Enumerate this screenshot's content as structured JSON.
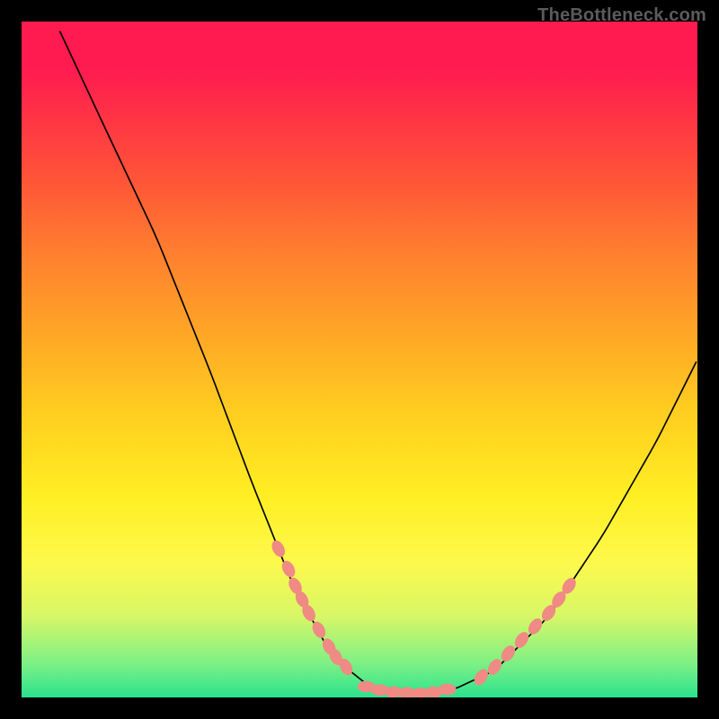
{
  "watermark": "TheBottleneck.com",
  "chart_data": {
    "type": "line",
    "title": "",
    "xlabel": "",
    "ylabel": "",
    "xlim": [
      0,
      100
    ],
    "ylim": [
      0,
      100
    ],
    "curve": {
      "name": "bottleneck-curve",
      "points": [
        {
          "x": 5,
          "y": 100
        },
        {
          "x": 12,
          "y": 85
        },
        {
          "x": 20,
          "y": 68
        },
        {
          "x": 28,
          "y": 48
        },
        {
          "x": 34,
          "y": 32
        },
        {
          "x": 40,
          "y": 17
        },
        {
          "x": 46,
          "y": 6
        },
        {
          "x": 52,
          "y": 1.2
        },
        {
          "x": 58,
          "y": 0.6
        },
        {
          "x": 64,
          "y": 1.2
        },
        {
          "x": 70,
          "y": 4
        },
        {
          "x": 78,
          "y": 12
        },
        {
          "x": 86,
          "y": 24
        },
        {
          "x": 94,
          "y": 38
        },
        {
          "x": 100,
          "y": 50
        }
      ]
    },
    "marker_clusters": [
      {
        "name": "left-cluster",
        "points": [
          {
            "x": 38,
            "y": 22
          },
          {
            "x": 39.5,
            "y": 19
          },
          {
            "x": 40.5,
            "y": 16.5
          },
          {
            "x": 41.5,
            "y": 14.5
          },
          {
            "x": 42.5,
            "y": 12.5
          },
          {
            "x": 44,
            "y": 10
          },
          {
            "x": 45.5,
            "y": 7.5
          },
          {
            "x": 46.5,
            "y": 6
          },
          {
            "x": 48,
            "y": 4.5
          }
        ]
      },
      {
        "name": "trough-cluster",
        "points": [
          {
            "x": 51,
            "y": 1.6
          },
          {
            "x": 53,
            "y": 1.1
          },
          {
            "x": 55,
            "y": 0.8
          },
          {
            "x": 57,
            "y": 0.7
          },
          {
            "x": 59,
            "y": 0.6
          },
          {
            "x": 61,
            "y": 0.8
          },
          {
            "x": 63,
            "y": 1.2
          }
        ]
      },
      {
        "name": "right-cluster",
        "points": [
          {
            "x": 68,
            "y": 3
          },
          {
            "x": 70,
            "y": 4.5
          },
          {
            "x": 72,
            "y": 6.5
          },
          {
            "x": 74,
            "y": 8.5
          },
          {
            "x": 76,
            "y": 10.5
          },
          {
            "x": 78,
            "y": 12.5
          },
          {
            "x": 79.5,
            "y": 14.5
          },
          {
            "x": 81,
            "y": 16.5
          }
        ]
      }
    ],
    "colors": {
      "curve_stroke": "#000000",
      "marker_fill": "#f08a84"
    }
  }
}
